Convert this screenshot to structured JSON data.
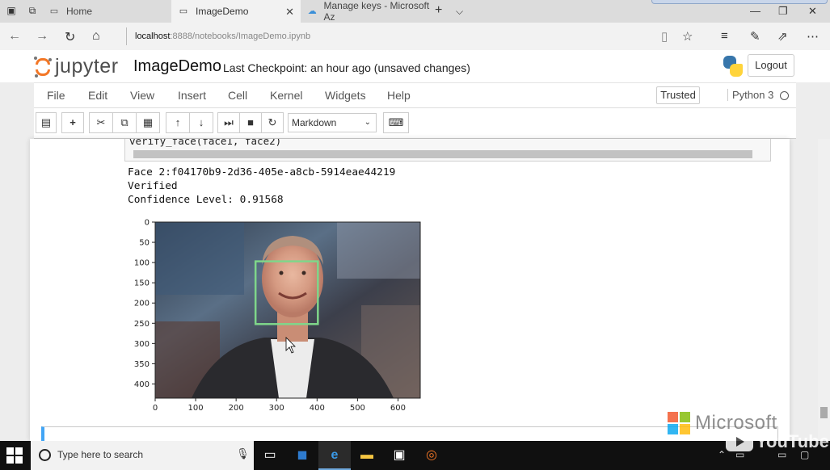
{
  "browser": {
    "tabs": [
      {
        "label": "Home",
        "active": false
      },
      {
        "label": "ImageDemo",
        "active": true
      },
      {
        "label": "Manage keys - Microsoft Az",
        "active": false
      }
    ],
    "url_host": "localhost",
    "url_path": ":8888/notebooks/ImageDemo.ipynb"
  },
  "jupyter": {
    "logo_text": "jupyter",
    "notebook_name": "ImageDemo",
    "checkpoint": "Last Checkpoint: an hour ago (unsaved changes)",
    "logout_label": "Logout",
    "menu": [
      "File",
      "Edit",
      "View",
      "Insert",
      "Cell",
      "Kernel",
      "Widgets",
      "Help"
    ],
    "trusted_label": "Trusted",
    "kernel_name": "Python 3",
    "cell_type": "Markdown"
  },
  "cell": {
    "code_tail": "verify_face(face1, face2)",
    "output_lines": [
      "Face 2:f04170b9-2d36-405e-a8cb-5914eae44219",
      "Verified",
      "Confidence Level: 0.91568"
    ]
  },
  "chart_data": {
    "type": "image",
    "x_ticks": [
      0,
      100,
      200,
      300,
      400,
      500,
      600
    ],
    "y_ticks": [
      0,
      50,
      100,
      150,
      200,
      250,
      300,
      350,
      400
    ],
    "xlim": [
      0,
      655
    ],
    "ylim": [
      435,
      0
    ],
    "face_box": {
      "x0": 248,
      "y0": 97,
      "x1": 402,
      "y1": 252,
      "color": "#7fd68a"
    }
  },
  "watermark": "Microsoft",
  "taskbar": {
    "search_placeholder": "Type here to search",
    "youtube_label": "YouTube"
  }
}
